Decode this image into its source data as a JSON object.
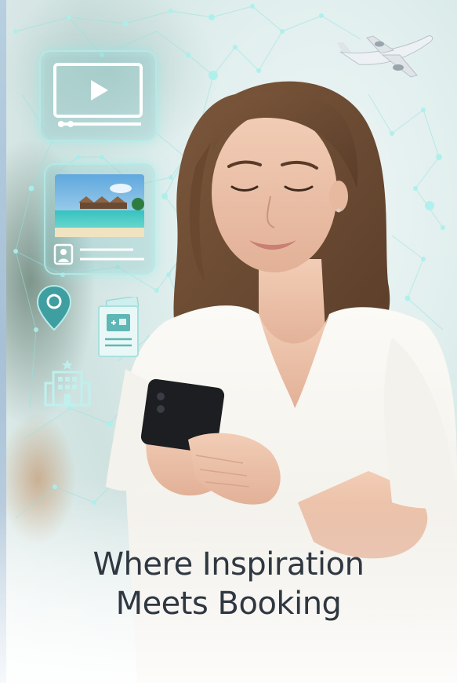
{
  "headline": {
    "line1": "Where Inspiration",
    "line2": "Meets Booking"
  },
  "icons": [
    "play-video-icon",
    "beach-photo-icon",
    "profile-card-icon",
    "map-pin-icon",
    "ticket-document-icon",
    "hotel-icon",
    "airplane-icon",
    "smartphone-icon"
  ],
  "colors": {
    "headline": "#2f3740",
    "accent_teal": "#7fd6d2",
    "pin": "#3f9ea0",
    "shirt": "#f6f4ef",
    "hair": "#6b4a33"
  }
}
